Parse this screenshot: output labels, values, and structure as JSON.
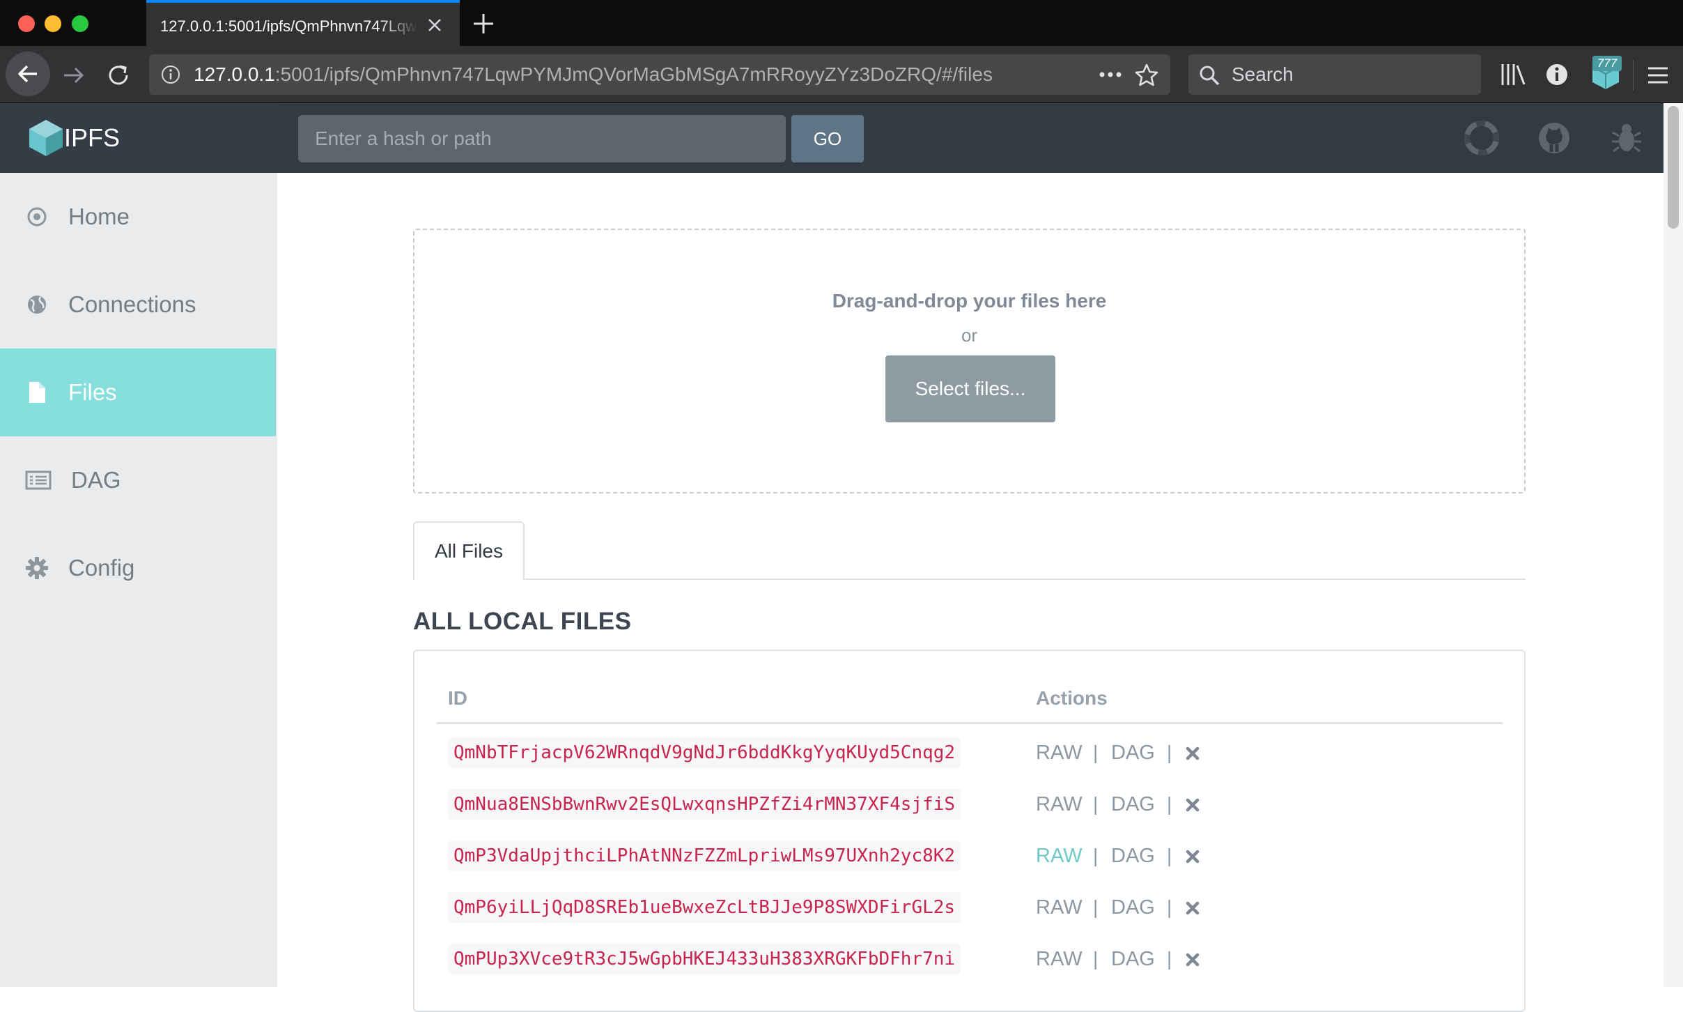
{
  "browser": {
    "tab_title": "127.0.0.1:5001/ipfs/QmPhnvn747Lqw",
    "url_host": "127.0.0.1",
    "url_rest": ":5001/ipfs/QmPhnvn747LqwPYMJmQVorMaGbMSgA7mRRoyyZYz3DoZRQ/#/files",
    "search_placeholder": "Search",
    "extension_badge": "777"
  },
  "header": {
    "brand": "IPFS",
    "hash_placeholder": "Enter a hash or path",
    "go_label": "GO"
  },
  "sidebar": {
    "items": [
      {
        "label": "Home",
        "icon": "target-icon"
      },
      {
        "label": "Connections",
        "icon": "globe-icon"
      },
      {
        "label": "Files",
        "icon": "file-icon",
        "active": true
      },
      {
        "label": "DAG",
        "icon": "list-icon"
      },
      {
        "label": "Config",
        "icon": "gear-icon"
      }
    ]
  },
  "upload": {
    "title": "Drag-and-drop your files here",
    "or": "or",
    "select_label": "Select files..."
  },
  "tabs": {
    "all_files": "All Files"
  },
  "files": {
    "section_title": "ALL LOCAL FILES",
    "col_id": "ID",
    "col_actions": "Actions",
    "raw_label": "RAW",
    "dag_label": "DAG",
    "separator": "|",
    "rows": [
      {
        "id": "QmNbTFrjacpV62WRnqdV9gNdJr6bddKkgYyqKUyd5Cnqg2"
      },
      {
        "id": "QmNua8ENSbBwnRwv2EsQLwxqnsHPZfZi4rMN37XF4sjfiS"
      },
      {
        "id": "QmP3VdaUpjthciLPhAtNNzFZZmLpriwLMs97UXnh2yc8K2"
      },
      {
        "id": "QmP6yiLLjQqD8SREb1ueBwxeZcLtBJJe9P8SWXDFirGL2s"
      },
      {
        "id": "QmPUp3XVce9tR3cJ5wGpbHKEJ433uH383XRGKFbDFhr7ni"
      }
    ]
  },
  "colors": {
    "accent": "#86dedd",
    "header_bg": "#333a43",
    "hash_text": "#c7254e"
  }
}
